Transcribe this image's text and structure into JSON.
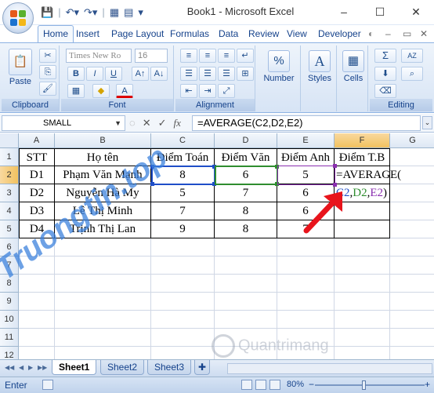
{
  "app": {
    "title": "Book1 - Microsoft Excel",
    "window_controls": [
      "–",
      "☐",
      "✕"
    ]
  },
  "quick_access": [
    "save-icon",
    "undo-icon",
    "redo-icon",
    "table-icon",
    "menu-icon"
  ],
  "ribbon": {
    "tabs": [
      "Home",
      "Insert",
      "Page Layout",
      "Formulas",
      "Data",
      "Review",
      "View",
      "Developer"
    ],
    "active_tab": "Home",
    "groups": {
      "clipboard": {
        "label": "Clipboard",
        "paste": "Paste"
      },
      "font": {
        "label": "Font",
        "font_name": "Times New Ro",
        "font_size": "16",
        "bold": "B",
        "italic": "I",
        "underline": "U",
        "font_color": "A"
      },
      "alignment": {
        "label": "Alignment"
      },
      "number": {
        "label": "Number",
        "symbol": "%"
      },
      "styles": {
        "label": "Styles",
        "symbol": "A"
      },
      "cells": {
        "label": "Cells"
      },
      "editing": {
        "label": "Editing",
        "sum": "Σ",
        "sort": "AZ"
      }
    }
  },
  "formula_bar": {
    "name_box": "SMALL",
    "cancel": "✕",
    "enter": "✓",
    "fx": "fx",
    "formula": "=AVERAGE(C2,D2,E2)"
  },
  "sheet": {
    "columns": [
      "A",
      "B",
      "C",
      "D",
      "E",
      "F",
      "G"
    ],
    "rows": [
      "1",
      "2",
      "3",
      "4",
      "5",
      "6",
      "7",
      "8",
      "9",
      "10",
      "11",
      "12"
    ],
    "header": [
      "STT",
      "Họ tên",
      "Điểm Toán",
      "Điểm Văn",
      "Điểm Anh",
      "Điểm T.B"
    ],
    "data": [
      [
        "D1",
        "Phạm Văn Mạnh",
        "8",
        "6",
        "5"
      ],
      [
        "D2",
        "Nguyễn Hà My",
        "5",
        "7",
        "6"
      ],
      [
        "D3",
        "Lê Thị Minh",
        "7",
        "8",
        "6"
      ],
      [
        "D4",
        "Trịnh Thị Lan",
        "9",
        "8",
        "7"
      ]
    ],
    "edit_line1": "=AVERAGE(",
    "edit_line2": {
      "c": "C2",
      "comma1": ",",
      "d": "D2",
      "comma2": ",",
      "e": "E2",
      "close": ")"
    },
    "ref_colors": {
      "c": "#1f4ec8",
      "d": "#2f8d2f",
      "e": "#8b2fb0"
    }
  },
  "watermarks": {
    "site": "Truongtin.top",
    "logo": "Quantrimang"
  },
  "sheet_tabs": [
    "Sheet1",
    "Sheet2",
    "Sheet3"
  ],
  "active_sheet": "Sheet1",
  "status": {
    "mode": "Enter",
    "zoom": "80%"
  },
  "colors": {
    "accent": "#15428b",
    "arrow": "#e8141c",
    "selection": "#f1c15f"
  }
}
